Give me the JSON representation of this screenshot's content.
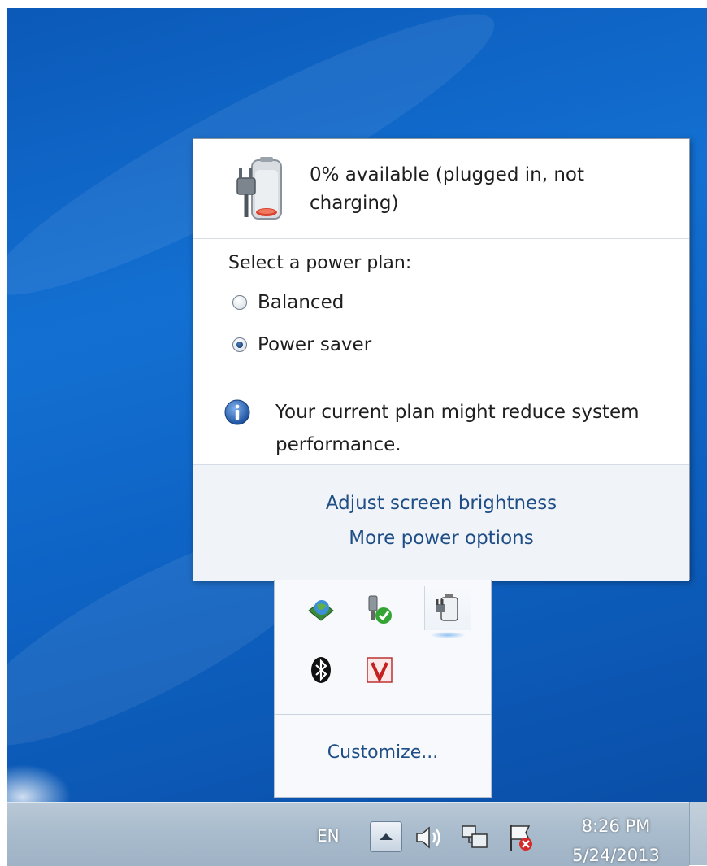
{
  "desktop": {
    "background_color": "#0d63c4"
  },
  "battery_flyout": {
    "status": "0% available (plugged in, not charging)",
    "battery_percent": 0,
    "power_plan_label": "Select a power plan:",
    "plans": [
      {
        "label": "Balanced",
        "selected": false
      },
      {
        "label": "Power saver",
        "selected": true
      }
    ],
    "info_message": "Your current plan might reduce system performance.",
    "links": {
      "brightness": "Adjust screen brightness",
      "more_options": "More power options"
    }
  },
  "tray_overflow": {
    "icons": [
      "network-globe-icon",
      "safely-remove-hardware-icon",
      "power-plug-icon",
      "bluetooth-icon",
      "antivirus-v-icon"
    ],
    "customize_label": "Customize..."
  },
  "taskbar": {
    "language": "EN",
    "icons": [
      "show-hidden-icons-button",
      "speaker-icon",
      "network-icon",
      "action-center-flag-icon"
    ],
    "time": "8:26 PM",
    "date": "5/24/2013"
  },
  "colors": {
    "link": "#1f4e86",
    "taskbar": "#a9bccd",
    "footer": "#f0f4f9"
  }
}
